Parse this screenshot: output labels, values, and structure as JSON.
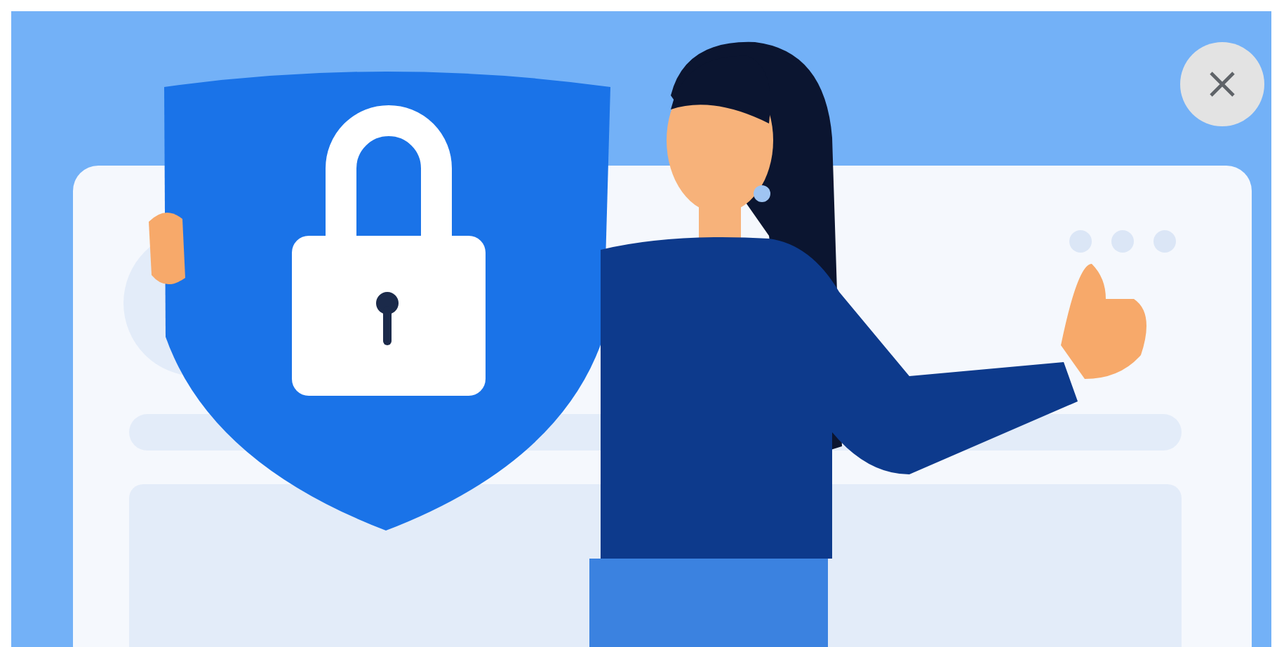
{
  "dialog": {
    "close_button": {
      "visible": true
    }
  }
}
